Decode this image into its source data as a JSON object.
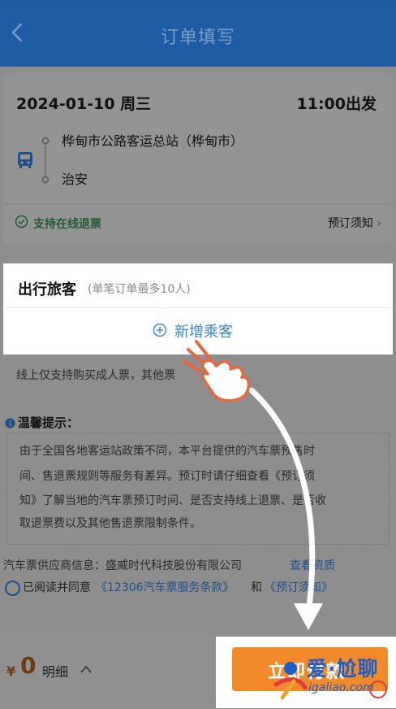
{
  "colors": {
    "primary_blue": "#3b86d8",
    "nav_blue": "#1f5ca3",
    "submit_orange": "#f28a2a",
    "refund_green": "#215a34",
    "price": "#6b3a10"
  },
  "nav": {
    "title": "订单填写",
    "back_icon": "chevron-left-icon"
  },
  "trip": {
    "date": "2024-01-10 周三",
    "depart_time": "11:00出发",
    "from_station": "桦甸市公路客运总站（桦甸市）",
    "to_station": "治安",
    "refund_label": "支持在线退票",
    "notice_label": "预订须知",
    "bus_icon": "bus-icon"
  },
  "travelers": {
    "title": "出行旅客",
    "limit_note": "(单笔订单最多10人)",
    "add_label": "新增乘客",
    "adult_only_note": "线上仅支持购买成人票，其他票         站购买。"
  },
  "tips": {
    "title": "温馨提示：",
    "lines": [
      "由于全国各地客运站政策不同，本平台提供的汽车票预售时",
      "间、售退票规则等服务有差异。预订时请仔细查看《预订须",
      "知》了解当地的汽车票预订时间、是否支持线上退票、是否收",
      "取退票费以及其他售退票限制条件。"
    ]
  },
  "supplier": {
    "label": "汽车票供应商信息：盛威时代科技股份有限公司",
    "link": "查看资质"
  },
  "agreement": {
    "prefix": "已阅读并同意",
    "link1": "《12306汽车票服务条款》",
    "and": "和",
    "link2": "《预订须知》"
  },
  "bottom": {
    "currency": "¥",
    "price": "0",
    "detail_label": "明细",
    "submit_label": "立即付款"
  },
  "watermark": {
    "brand": "爱·尬聊",
    "url": "igaliao.com"
  }
}
